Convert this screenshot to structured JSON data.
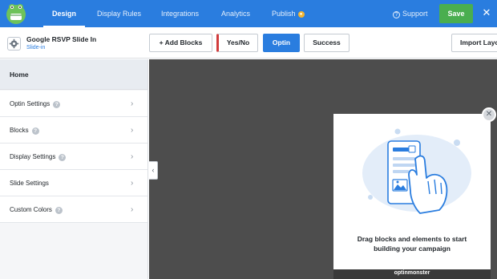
{
  "nav": {
    "tabs": [
      {
        "label": "Design"
      },
      {
        "label": "Display Rules"
      },
      {
        "label": "Integrations"
      },
      {
        "label": "Analytics"
      },
      {
        "label": "Publish"
      }
    ],
    "support": "Support",
    "save": "Save"
  },
  "campaign": {
    "name": "Google RSVP Slide In",
    "type": "Slide-in"
  },
  "toolbar": {
    "add_blocks": "+ Add Blocks",
    "yes_no": "Yes/No",
    "optin": "Optin",
    "success": "Success",
    "import": "Import Layo"
  },
  "sidebar": {
    "home": "Home",
    "items": [
      {
        "label": "Optin Settings",
        "help": true
      },
      {
        "label": "Blocks",
        "help": true
      },
      {
        "label": "Display Settings",
        "help": true
      },
      {
        "label": "Slide Settings",
        "help": false
      },
      {
        "label": "Custom Colors",
        "help": true
      }
    ]
  },
  "slidein": {
    "line1": "Drag blocks and elements to start",
    "line2": "building your campaign",
    "brand": "optinmonster"
  },
  "colors": {
    "brand_blue": "#2a7ddf",
    "save_green": "#4aae4f",
    "canvas": "#4d4d4d"
  }
}
